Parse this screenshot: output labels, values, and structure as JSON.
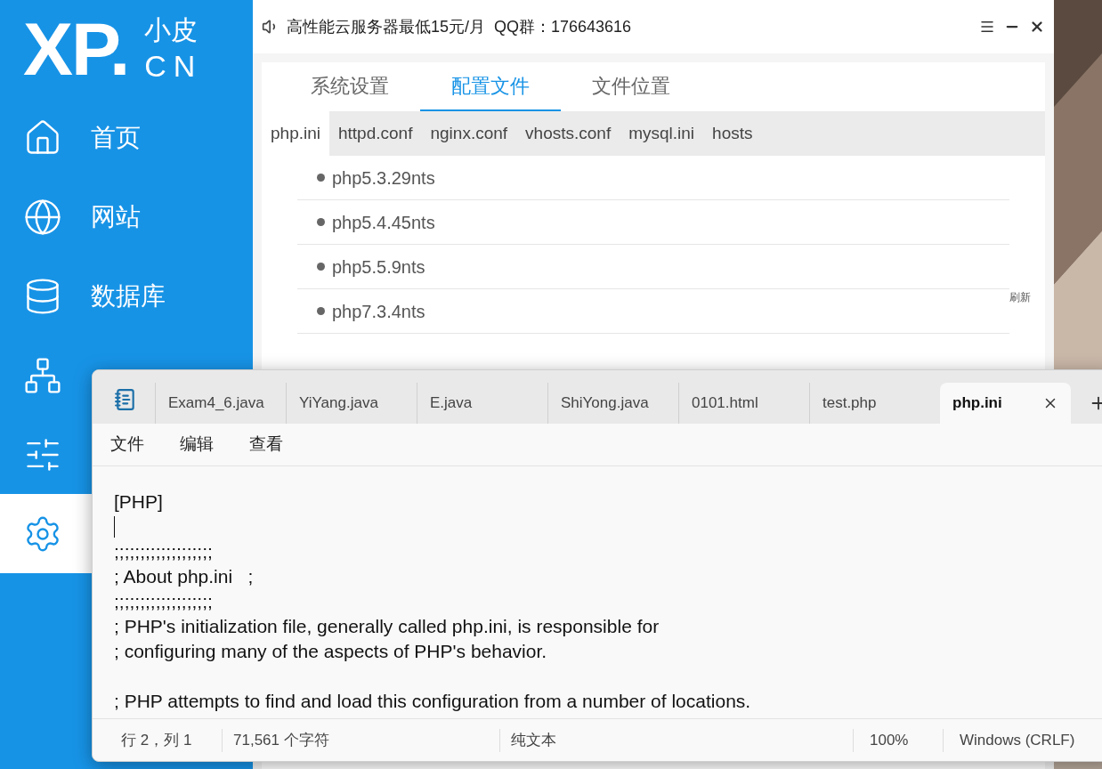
{
  "sidebar": {
    "logo": {
      "mark": "XP.",
      "name": "小皮",
      "domain": "CN"
    },
    "items": [
      {
        "label": "首页",
        "selected": false
      },
      {
        "label": "网站",
        "selected": false
      },
      {
        "label": "数据库",
        "selected": false
      },
      {
        "selected": false
      },
      {
        "selected": false
      },
      {
        "selected": true
      }
    ]
  },
  "app": {
    "notice": "高性能云服务器最低15元/月  QQ群：176643616",
    "tabs": [
      {
        "label": "系统设置",
        "selected": false
      },
      {
        "label": "配置文件",
        "selected": true
      },
      {
        "label": "文件位置",
        "selected": false
      }
    ],
    "file_tabs": [
      {
        "label": "php.ini",
        "selected": true
      },
      {
        "label": "httpd.conf",
        "selected": false
      },
      {
        "label": "nginx.conf",
        "selected": false
      },
      {
        "label": "vhosts.conf",
        "selected": false
      },
      {
        "label": "mysql.ini",
        "selected": false
      },
      {
        "label": "hosts",
        "selected": false
      }
    ],
    "versions": [
      "php5.3.29nts",
      "php5.4.45nts",
      "php5.5.9nts",
      "php7.3.4nts"
    ],
    "refresh": "刷新"
  },
  "notepad": {
    "tabs": [
      {
        "label": "Exam4_6.java",
        "selected": false
      },
      {
        "label": "YiYang.java",
        "selected": false
      },
      {
        "label": "E.java",
        "selected": false
      },
      {
        "label": "ShiYong.java",
        "selected": false
      },
      {
        "label": "0101.html",
        "selected": false
      },
      {
        "label": "test.php",
        "selected": false
      },
      {
        "label": "php.ini",
        "selected": true
      }
    ],
    "menu": [
      "文件",
      "编辑",
      "查看"
    ],
    "lines": [
      {
        "kind": "text",
        "text": "[PHP]"
      },
      {
        "kind": "cursor"
      },
      {
        "kind": "text",
        "text": ";;;;;;;;;;;;;;;;;;;"
      },
      {
        "kind": "text",
        "text": "; About php.ini   ;"
      },
      {
        "kind": "text",
        "text": ";;;;;;;;;;;;;;;;;;;"
      },
      {
        "kind": "text",
        "text": "; PHP's initialization file, generally called php.ini, is responsible for"
      },
      {
        "kind": "text",
        "text": "; configuring many of the aspects of PHP's behavior."
      },
      {
        "kind": "blank"
      },
      {
        "kind": "text",
        "text": "; PHP attempts to find and load this configuration from a number of locations."
      }
    ],
    "status": [
      "行 2，列 1",
      "71,561 个字符",
      "纯文本",
      "100%",
      "Windows (CRLF)"
    ]
  }
}
